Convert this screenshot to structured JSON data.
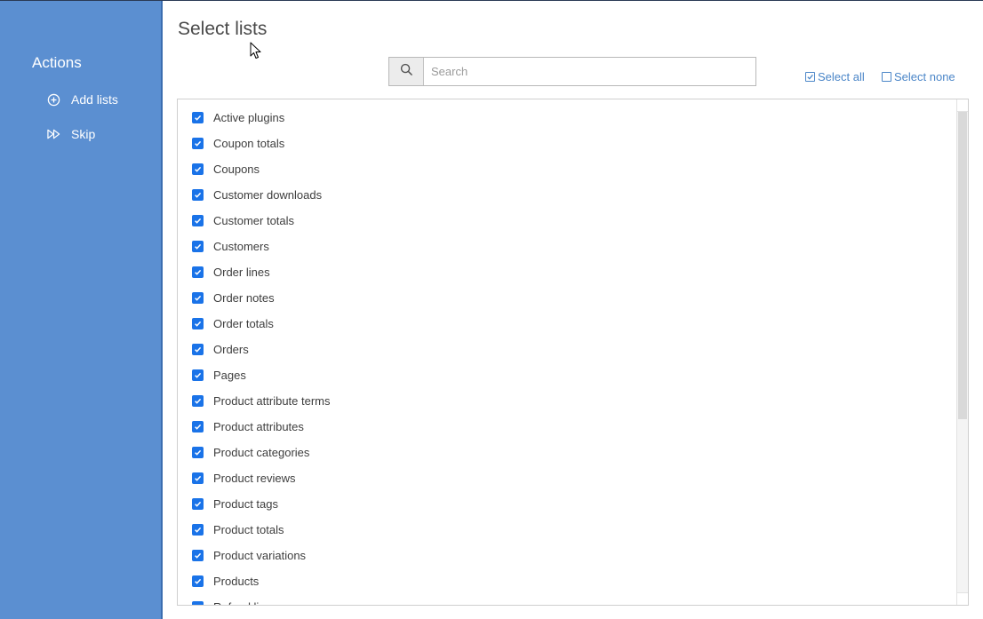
{
  "sidebar": {
    "title": "Actions",
    "items": [
      {
        "label": "Add lists",
        "icon": "plus-circle-icon"
      },
      {
        "label": "Skip",
        "icon": "fast-forward-icon"
      }
    ]
  },
  "main": {
    "title": "Select lists",
    "search": {
      "placeholder": "Search",
      "value": ""
    },
    "select_all_label": "Select all",
    "select_none_label": "Select none"
  },
  "lists": [
    "Active plugins",
    "Coupon totals",
    "Coupons",
    "Customer downloads",
    "Customer totals",
    "Customers",
    "Order lines",
    "Order notes",
    "Order totals",
    "Orders",
    "Pages",
    "Product attribute terms",
    "Product attributes",
    "Product categories",
    "Product reviews",
    "Product tags",
    "Product totals",
    "Product variations",
    "Products",
    "Refund lines"
  ],
  "colors": {
    "sidebar_bg": "#5b8fd1",
    "checkbox_checked": "#1a73e8",
    "link": "#4b86c8"
  }
}
